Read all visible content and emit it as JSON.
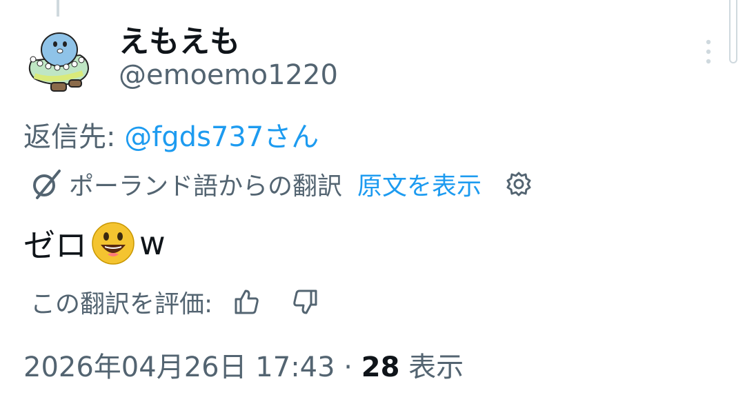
{
  "author": {
    "display_name": "えもえも",
    "handle": "@emoemo1220"
  },
  "reply": {
    "prefix": "返信先: ",
    "mention": "@fgds737さん"
  },
  "translation": {
    "label": "ポーランド語からの翻訳",
    "show_original": "原文を表示"
  },
  "tweet": {
    "text_before": "ゼロ",
    "emoji": "grinning-face-emoji",
    "text_after": "w"
  },
  "rating": {
    "label": "この翻訳を評価: "
  },
  "meta": {
    "timestamp": "2026年04月26日 17:43",
    "separator": " · ",
    "views_count": "28",
    "views_label": " 表示"
  },
  "colors": {
    "text_primary": "#0f1419",
    "text_secondary": "#536471",
    "link": "#1d9bf0"
  }
}
